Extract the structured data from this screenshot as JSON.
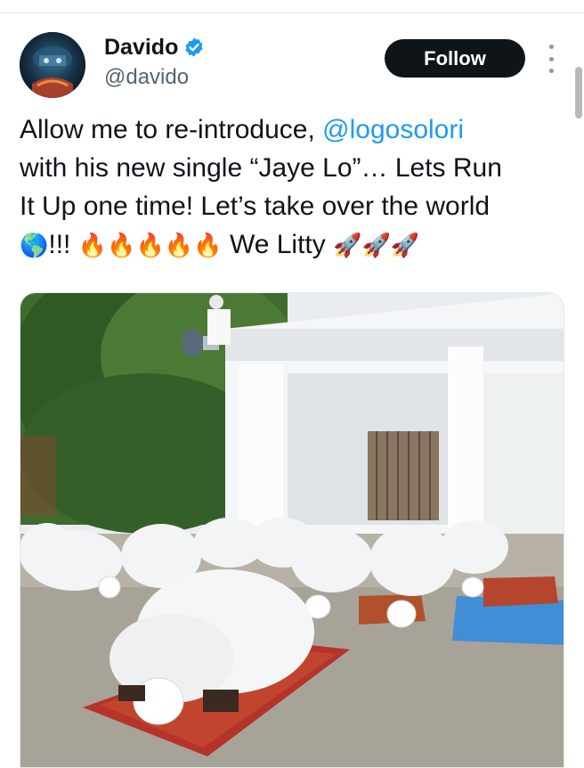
{
  "tweet": {
    "author": {
      "display_name": "Davido",
      "handle": "@davido",
      "verified": true,
      "avatar_icon": "avatar-image"
    },
    "follow_label": "Follow",
    "more_icon": "more-vertical-icon",
    "text": {
      "line1_prefix": "Allow me to re-introduce, ",
      "mention": "@logosolori",
      "line2": "with his new single “Jaye Lo”… Lets Run",
      "line3": "It Up one time! Let’s take over the world",
      "globe": "🌎",
      "exclaim": "!!!",
      "fires": "🔥🔥🔥🔥🔥",
      "we_litty": " We Litty ",
      "rockets": "🚀🚀🚀"
    },
    "media_description_icon": "photo-prayer-scene"
  },
  "colors": {
    "text": "#0f1419",
    "secondary": "#536471",
    "link": "#1d9bf0",
    "follow_bg": "#0f1419",
    "follow_text": "#ffffff",
    "verified": "#1d9bf0"
  }
}
